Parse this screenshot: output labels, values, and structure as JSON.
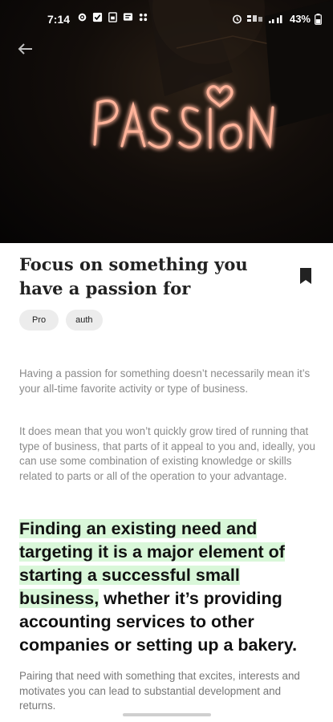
{
  "status_bar": {
    "time": "7:14",
    "battery": "43%",
    "left_icons": [
      "settings-icon",
      "checkbox-icon",
      "sim-icon",
      "message-icon",
      "dots-grid-icon"
    ],
    "right_icons": [
      "alarm-icon",
      "volte-icon",
      "signal-icon",
      "battery-icon"
    ]
  },
  "hero": {
    "image_text": "PASSION",
    "back_icon": "arrow-left-icon"
  },
  "article": {
    "title": "Focus on something you have a passion for",
    "bookmark_icon": "bookmark-icon",
    "tags": [
      "Pro",
      "auth"
    ],
    "paragraphs": [
      "Having a passion for something doesn’t necessarily mean it’s your all-time favorite activity or type of business.",
      "It does mean that you won’t quickly grow tired of running that type of business, that parts of it appeal to you and, ideally, you can use some combination of existing knowledge or skills related to parts or all of the operation to your advantage."
    ],
    "quote_highlight": "Finding an existing need and targeting it is a major element of starting a successful small business,",
    "quote_rest": " whether it’s providing accounting services to other companies or setting up a bakery.",
    "closing": "Pairing that need with something that excites, interests and motivates you can lead to substantial development and returns."
  },
  "colors": {
    "highlight": "#d9f7d9",
    "neon": "#ff7a5c"
  }
}
